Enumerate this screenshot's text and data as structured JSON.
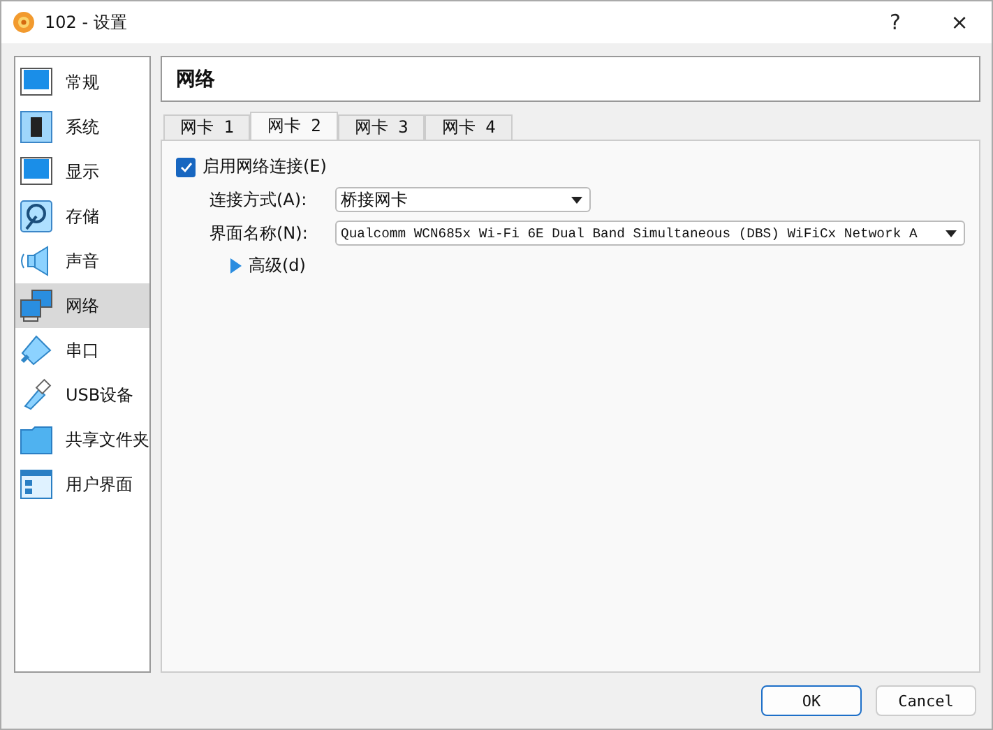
{
  "window": {
    "title": "102 - 设置",
    "buttons": [
      "?",
      "×"
    ]
  },
  "sidebar": {
    "items": [
      {
        "label": "常规",
        "kind": "general",
        "selected": false
      },
      {
        "label": "系统",
        "kind": "system",
        "selected": false
      },
      {
        "label": "显示",
        "kind": "display",
        "selected": false
      },
      {
        "label": "存储",
        "kind": "storage",
        "selected": false
      },
      {
        "label": "声音",
        "kind": "audio",
        "selected": false
      },
      {
        "label": "网络",
        "kind": "network",
        "selected": true
      },
      {
        "label": "串口",
        "kind": "serial",
        "selected": false
      },
      {
        "label": "USB设备",
        "kind": "usb",
        "selected": false
      },
      {
        "label": "共享文件夹",
        "kind": "folder",
        "selected": false
      },
      {
        "label": "用户界面",
        "kind": "ui",
        "selected": false
      }
    ]
  },
  "header": {
    "title": "网络"
  },
  "tabs": [
    {
      "label": "网卡 1",
      "selected": false
    },
    {
      "label": "网卡 2",
      "selected": true
    },
    {
      "label": "网卡 3",
      "selected": false
    },
    {
      "label": "网卡 4",
      "selected": false
    }
  ],
  "enable": {
    "label": "启用网络连接(E)",
    "checked": true
  },
  "fields": [
    {
      "label": "连接方式(A):",
      "value": "桥接网卡",
      "wide": false
    },
    {
      "label": "界面名称(N):",
      "value": "Qualcomm WCN685x Wi-Fi 6E Dual Band Simultaneous (DBS) WiFiCx Network A",
      "wide": true
    }
  ],
  "advanced": {
    "label": "高级(d)",
    "expanded": false
  },
  "buttons": [
    {
      "label": "OK",
      "default": true
    },
    {
      "label": "Cancel",
      "default": false
    }
  ]
}
